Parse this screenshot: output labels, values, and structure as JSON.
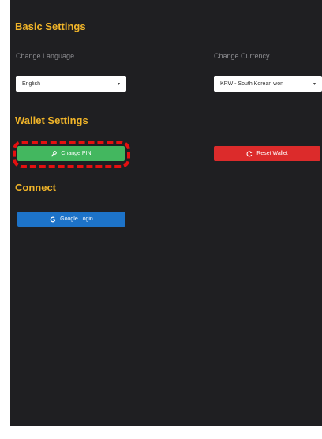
{
  "basic_settings": {
    "title": "Basic Settings",
    "language": {
      "label": "Change Language",
      "selected": "English"
    },
    "currency": {
      "label": "Change Currency",
      "selected": "KRW - South Korean won"
    }
  },
  "wallet_settings": {
    "title": "Wallet Settings",
    "change_pin_label": "Change PIN",
    "reset_wallet_label": "Reset Wallet"
  },
  "connect": {
    "title": "Connect",
    "google_login_label": "Google Login"
  },
  "icons": {
    "change_pin": "key-icon",
    "reset_wallet": "refresh-icon",
    "google_login": "google-icon"
  },
  "colors": {
    "background": "#1f1f22",
    "section_title": "#f0b429",
    "change_pin_button": "#43b75f",
    "reset_wallet_button": "#dc2b2b",
    "google_login_button": "#1d73c9",
    "highlight": "#e51010"
  }
}
